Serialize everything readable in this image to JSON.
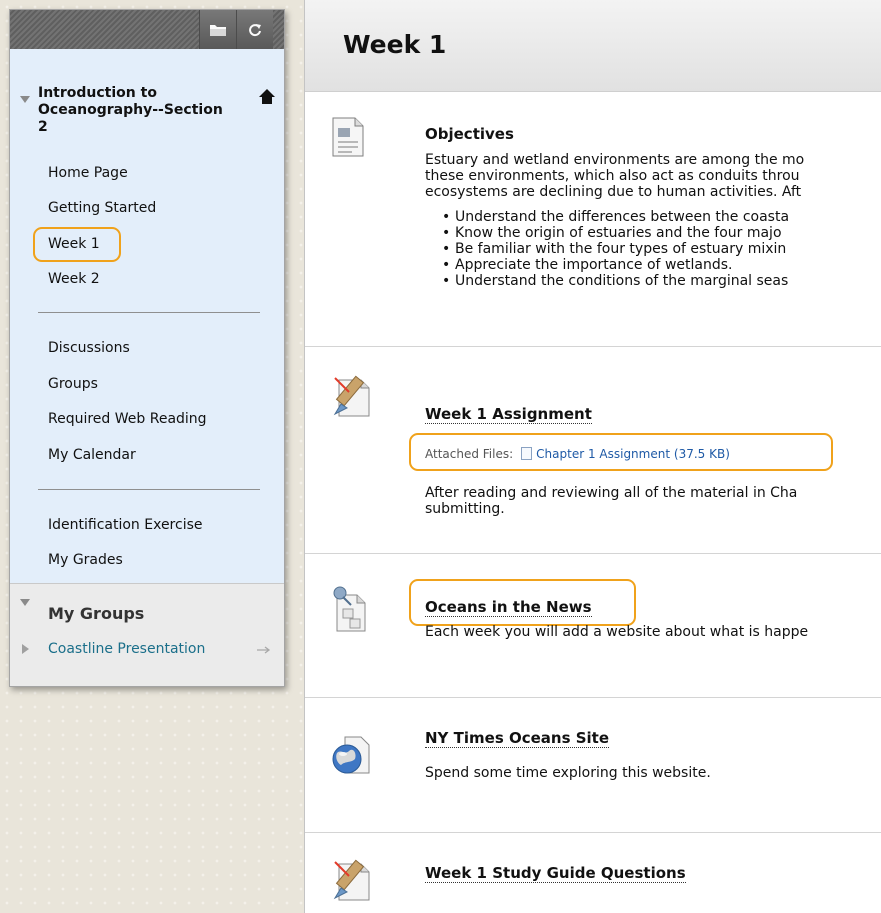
{
  "sidebar": {
    "course_title": "Introduction to Oceanography--Section 2",
    "course_title_lines": [
      "Introduction to",
      "Oceanography--Section",
      "2"
    ],
    "links_group1": [
      "Home Page",
      "Getting Started",
      "Week 1",
      "Week 2"
    ],
    "links_group2": [
      "Discussions",
      "Groups",
      "Required Web Reading",
      "My Calendar"
    ],
    "links_group3": [
      "Identification Exercise",
      "My Grades"
    ],
    "selected": "Week 1",
    "my_groups_title": "My Groups",
    "group_item": "Coastline Presentation",
    "icons": [
      "folder-icon",
      "refresh-icon",
      "home-icon",
      "arrow-right-icon"
    ]
  },
  "main": {
    "page_title": "Week 1",
    "items": [
      {
        "title": "Objectives",
        "icon": "document-icon",
        "paragraph": [
          "Estuary and wetland environments are among the mo",
          "these environments, which also act as conduits throu",
          "ecosystems are declining due to human activities. Aft"
        ],
        "bullets": [
          "Understand the differences between the coasta",
          "Know the origin of estuaries and the four majo",
          "Be familiar with the four types of estuary mixin",
          "Appreciate the importance of wetlands.",
          "Understand the conditions of the marginal seas"
        ]
      },
      {
        "title": "Week 1 Assignment",
        "icon": "assignment-icon",
        "attached_label": "Attached Files:",
        "attached_file": "Chapter 1 Assignment",
        "attached_size": "(37.5 KB)",
        "text": [
          "After reading and reviewing all of the material in Cha",
          "submitting."
        ]
      },
      {
        "title": "Oceans in the News",
        "icon": "blog-icon",
        "text": [
          "Each week you will add a website about what is happe"
        ]
      },
      {
        "title": "NY Times Oceans Site",
        "icon": "globe-icon",
        "text": [
          "Spend some time exploring this website."
        ]
      },
      {
        "title": "Week 1 Study Guide Questions",
        "icon": "assignment-icon"
      }
    ]
  },
  "colors": {
    "highlight": "#f0a21b",
    "sidebar_bg": "#e3eefa",
    "link_blue": "#1f5aa6",
    "group_link": "#1b6f8a"
  }
}
